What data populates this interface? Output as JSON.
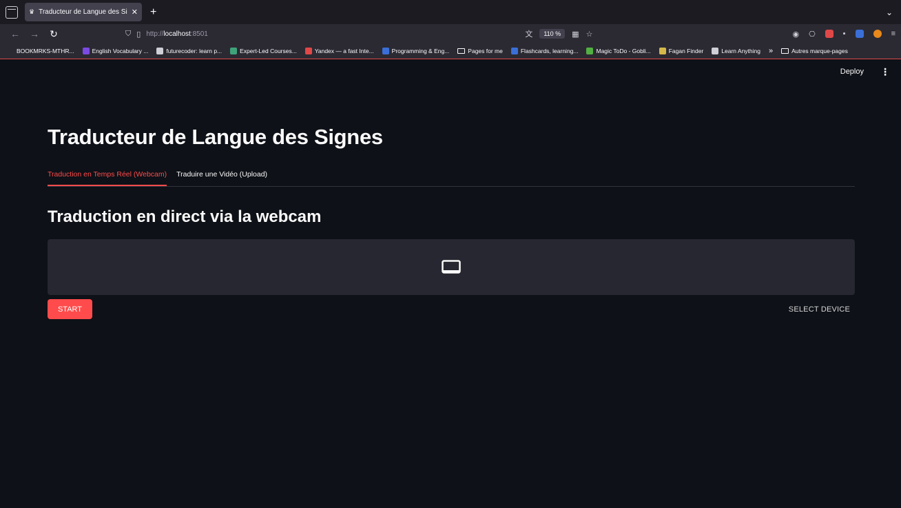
{
  "browser": {
    "tab_title": "Traducteur de Langue des Signes",
    "url_scheme": "http://",
    "url_host": "localhost",
    "url_port": ":8501",
    "zoom": "110 %",
    "bookmarks": [
      {
        "label": "BOOKMRKS-MTHR...",
        "color": "#2b2a33"
      },
      {
        "label": "English Vocabulary ...",
        "color": "#7b4ae2"
      },
      {
        "label": "futurecoder: learn p...",
        "color": "#cfcfd8"
      },
      {
        "label": "Expert-Led Courses...",
        "color": "#3fa37a"
      },
      {
        "label": "Yandex — a fast Inte...",
        "color": "#e04848"
      },
      {
        "label": "Programming & Eng...",
        "color": "#3a6fd8"
      },
      {
        "label": "Pages for me",
        "color": "folder"
      },
      {
        "label": "Flashcards, learning...",
        "color": "#3a6fd8"
      },
      {
        "label": "Magic ToDo - Gobli...",
        "color": "#52b043"
      },
      {
        "label": "Fagan Finder",
        "color": "#d4b84a"
      },
      {
        "label": "Learn Anything",
        "color": "#cfcfd8"
      }
    ],
    "other_bookmarks": "Autres marque-pages"
  },
  "app": {
    "deploy_label": "Deploy",
    "title": "Traducteur de Langue des Signes",
    "tabs": [
      {
        "label": "Traduction en Temps Réel (Webcam)",
        "active": true
      },
      {
        "label": "Traduire une Vidéo (Upload)",
        "active": false
      }
    ],
    "subtitle": "Traduction en direct via la webcam",
    "start_label": "START",
    "select_device_label": "SELECT DEVICE"
  }
}
